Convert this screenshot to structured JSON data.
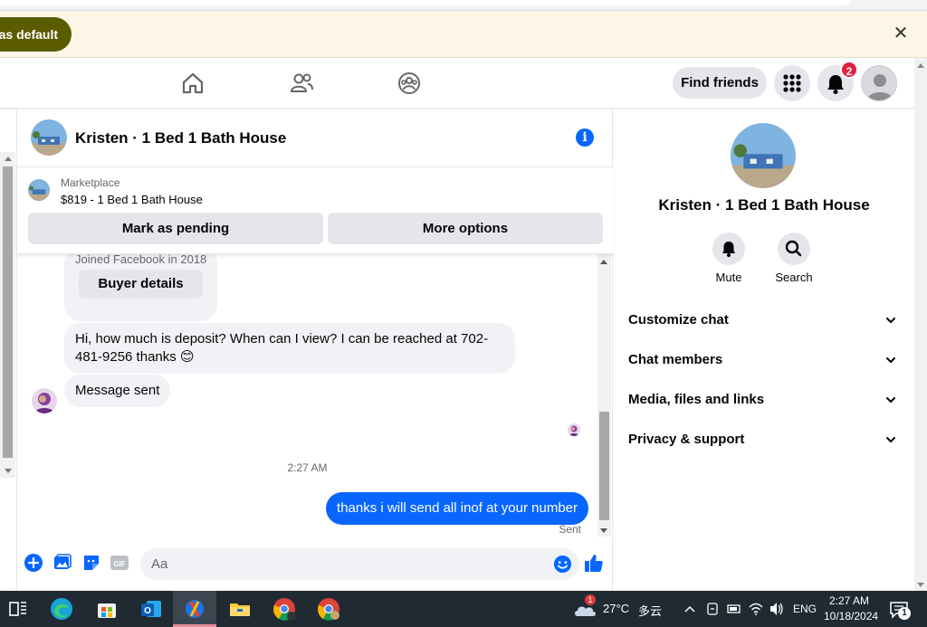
{
  "browser": {
    "infobar": {
      "default_label": "t as default",
      "close_label": "✕"
    }
  },
  "header": {
    "find_friends": "Find friends",
    "notification_count": "2"
  },
  "chat": {
    "title": "Kristen · 1 Bed 1 Bath House",
    "info_label": "i",
    "listing": {
      "category": "Marketplace",
      "price_title": "$819 - 1 Bed 1 Bath House",
      "mark_pending": "Mark as pending",
      "more_options": "More options"
    },
    "messages": {
      "joined": "Joined Facebook in 2018",
      "buyer_details": "Buyer details",
      "incoming_1": "Hi, how much is deposit? When can I view? I can be reached at 702-481-9256 thanks 😊",
      "incoming_2": "Message sent",
      "timestamp": "2:27 AM",
      "outgoing_1": "thanks i will send all inof at your number",
      "status": "Sent"
    },
    "composer": {
      "placeholder": "Aa"
    }
  },
  "details": {
    "title": "Kristen · 1 Bed 1 Bath House",
    "actions": [
      {
        "label": "Mute",
        "icon": "bell-icon"
      },
      {
        "label": "Search",
        "icon": "search-icon"
      }
    ],
    "rows": [
      {
        "label": "Customize chat"
      },
      {
        "label": "Chat members"
      },
      {
        "label": "Media, files and links"
      },
      {
        "label": "Privacy & support"
      }
    ]
  },
  "taskbar": {
    "weather_temp": "27°C",
    "weather_desc": "多云",
    "weather_badge": "1",
    "language": "ENG",
    "time": "2:27 AM",
    "date": "10/18/2024",
    "notif_count": "1"
  },
  "colors": {
    "fb_blue": "#0866ff",
    "badge_red": "#e41e3f",
    "bubble_gray": "#f0f2f5",
    "infobar_bg": "#fdf6e7",
    "taskbar_bg": "#1f2a33"
  }
}
